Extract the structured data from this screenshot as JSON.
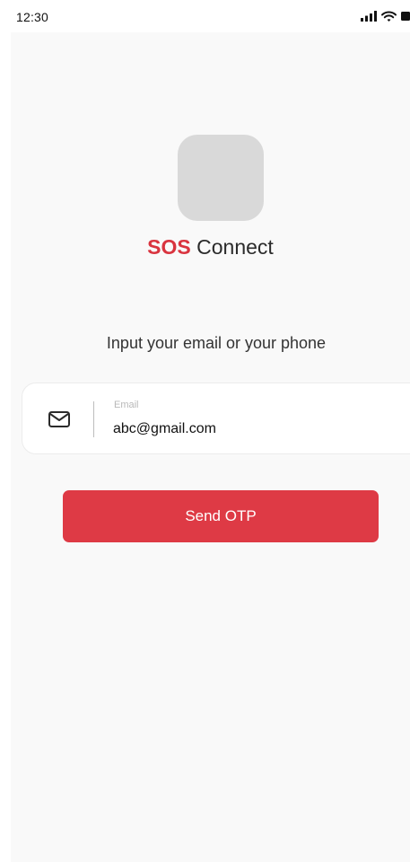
{
  "status_bar": {
    "time": "12:30",
    "icons": [
      "signal-icon",
      "wifi-icon",
      "battery-icon"
    ]
  },
  "app": {
    "logo": "app-logo-placeholder",
    "title_brand": "SOS",
    "title_rest": "Connect",
    "brand_color": "#d9343f"
  },
  "form": {
    "prompt": "Input your email or your phone",
    "email_icon": "mail-icon",
    "email_label": "Email",
    "email_value": "abc@gmail.com",
    "submit_label": "Send OTP",
    "button_color": "#de3a45"
  }
}
